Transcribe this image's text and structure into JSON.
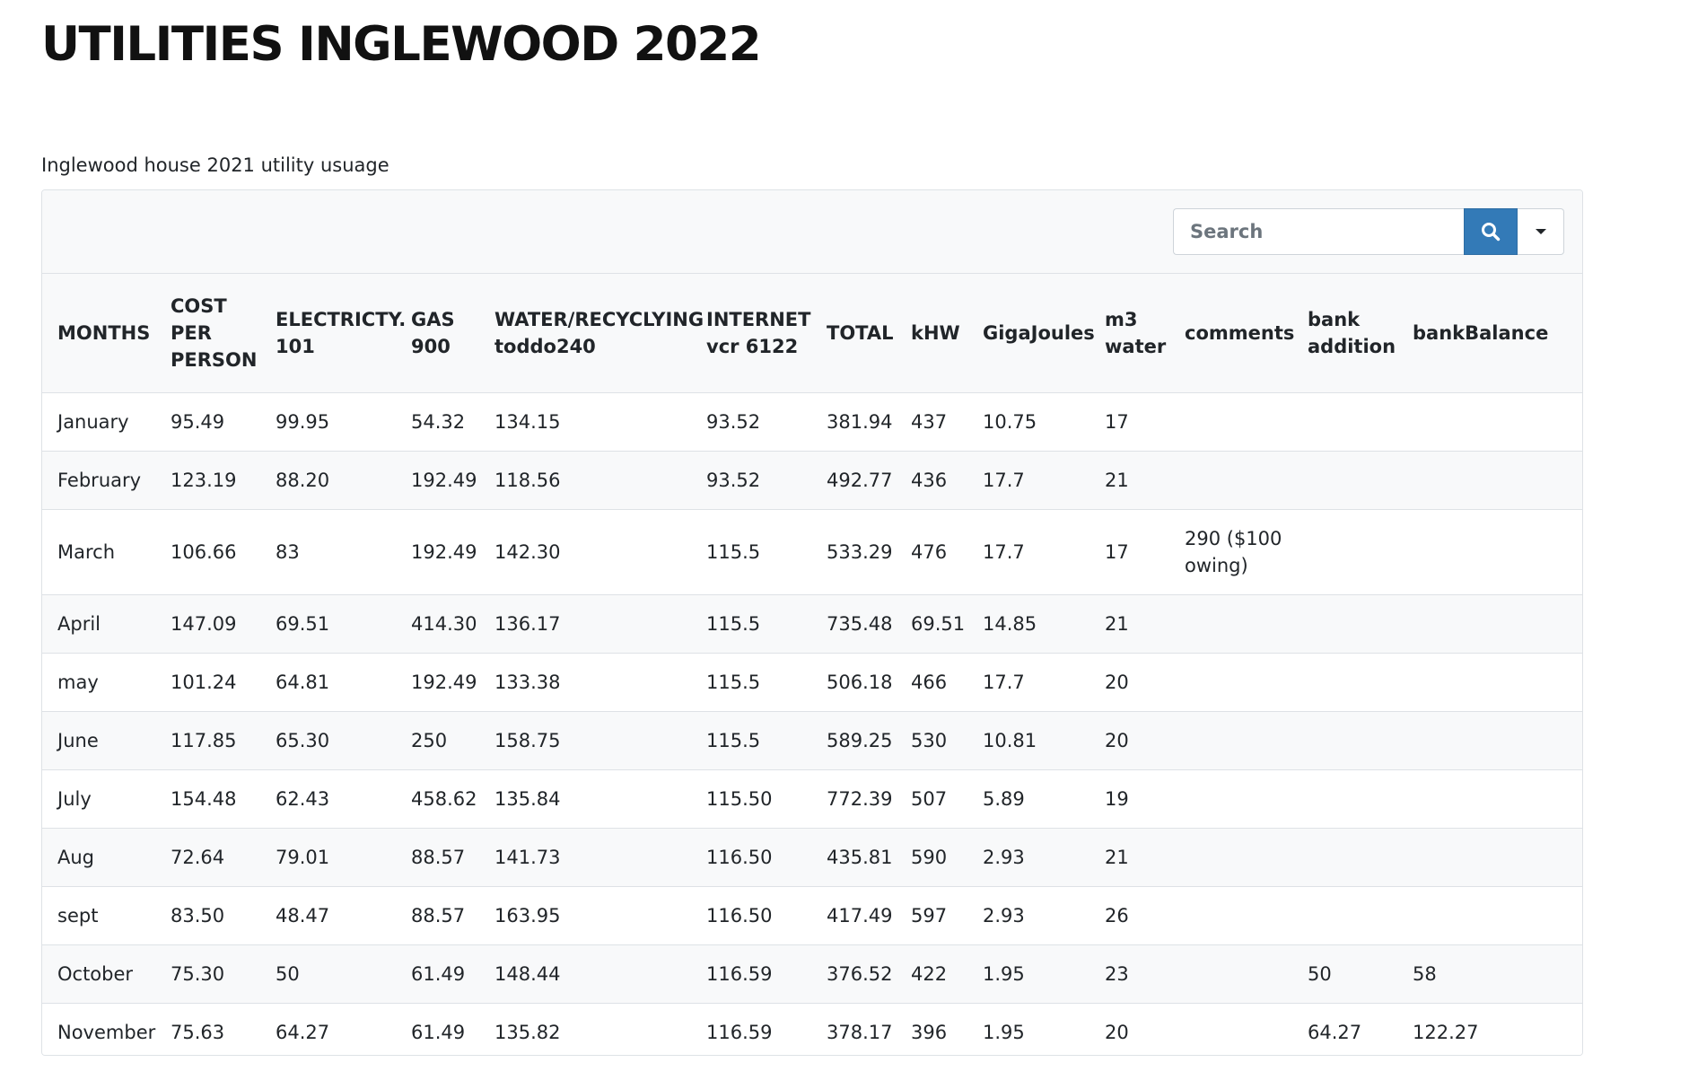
{
  "page": {
    "title": "UTILITIES INGLEWOOD 2022",
    "caption": "Inglewood house 2021 utility usuage"
  },
  "toolbar": {
    "search_placeholder": "Search",
    "search_icon": "search-icon",
    "dropdown_icon": "caret-down-icon"
  },
  "colors": {
    "search_button": "#337ab7",
    "stripe": "#f8f9fa",
    "border": "#dee2e6"
  },
  "table": {
    "headers": [
      "MONTHS",
      "COST PER PERSON",
      "ELECTRICTY. 101",
      "GAS 900",
      "WATER/RECYCLYING toddo240",
      "INTERNET vcr 6122",
      "TOTAL",
      "kHW",
      "GigaJoules",
      "m3 water",
      "comments",
      "bank addition",
      "bankBalance"
    ],
    "rows": [
      [
        "January",
        "95.49",
        "99.95",
        "54.32",
        "134.15",
        "93.52",
        "381.94",
        "437",
        "10.75",
        "17",
        "",
        "",
        ""
      ],
      [
        "February",
        "123.19",
        "88.20",
        "192.49",
        "118.56",
        "93.52",
        "492.77",
        "436",
        "17.7",
        "21",
        "",
        "",
        ""
      ],
      [
        "March",
        "106.66",
        "83",
        "192.49",
        "142.30",
        "115.5",
        "533.29",
        "476",
        "17.7",
        "17",
        "290 ($100 owing)",
        "",
        ""
      ],
      [
        "April",
        "147.09",
        "69.51",
        "414.30",
        "136.17",
        "115.5",
        "735.48",
        "69.51",
        "14.85",
        "21",
        "",
        "",
        ""
      ],
      [
        "may",
        "101.24",
        "64.81",
        "192.49",
        "133.38",
        "115.5",
        "506.18",
        "466",
        "17.7",
        "20",
        "",
        "",
        ""
      ],
      [
        "June",
        "117.85",
        "65.30",
        "250",
        "158.75",
        "115.5",
        "589.25",
        "530",
        "10.81",
        "20",
        "",
        "",
        ""
      ],
      [
        "July",
        "154.48",
        "62.43",
        "458.62",
        "135.84",
        "115.50",
        "772.39",
        "507",
        "5.89",
        "19",
        "",
        "",
        ""
      ],
      [
        "Aug",
        "72.64",
        "79.01",
        "88.57",
        "141.73",
        "116.50",
        "435.81",
        "590",
        "2.93",
        "21",
        "",
        "",
        ""
      ],
      [
        "sept",
        "83.50",
        "48.47",
        "88.57",
        "163.95",
        "116.50",
        "417.49",
        "597",
        "2.93",
        "26",
        "",
        "",
        ""
      ],
      [
        "October",
        "75.30",
        "50",
        "61.49",
        "148.44",
        "116.59",
        "376.52",
        "422",
        "1.95",
        "23",
        "",
        "50",
        "58"
      ],
      [
        "November",
        "75.63",
        "64.27",
        "61.49",
        "135.82",
        "116.59",
        "378.17",
        "396",
        "1.95",
        "20",
        "",
        "64.27",
        "122.27"
      ]
    ]
  }
}
